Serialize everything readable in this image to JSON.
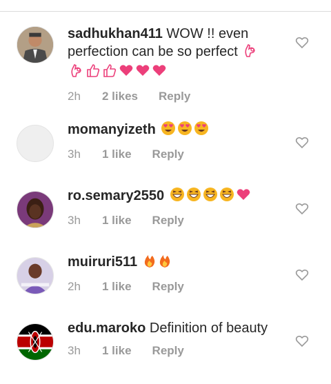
{
  "comments": [
    {
      "username": "sadhukhan411",
      "text_line1": " WOW !! even",
      "text_line2": "perfection can be so perfect",
      "emojis_line2": [
        "ok-hand"
      ],
      "emojis_line3": [
        "ok-hand",
        "thumbs-up",
        "thumbs-up",
        "heart",
        "heart",
        "heart"
      ],
      "time": "2h",
      "likes": "2 likes",
      "reply": "Reply",
      "avatar": "man-in-suit"
    },
    {
      "username": "momanyizeth",
      "text": "",
      "emojis": [
        "heart-eyes",
        "heart-eyes",
        "heart-eyes"
      ],
      "time": "3h",
      "likes": "1 like",
      "reply": "Reply",
      "avatar": "blank"
    },
    {
      "username": "ro.semary2550",
      "text": "",
      "emojis": [
        "laughing",
        "laughing",
        "laughing",
        "laughing",
        "heart"
      ],
      "time": "3h",
      "likes": "1 like",
      "reply": "Reply",
      "avatar": "woman-portrait"
    },
    {
      "username": "muiruri511",
      "text": "",
      "emojis": [
        "fire",
        "fire"
      ],
      "time": "2h",
      "likes": "1 like",
      "reply": "Reply",
      "avatar": "person-purple"
    },
    {
      "username": "edu.maroko",
      "text": " Definition of beauty",
      "emojis": [],
      "time": "3h",
      "likes": "1 like",
      "reply": "Reply",
      "avatar": "kenya-flag"
    }
  ],
  "colors": {
    "text": "#262626",
    "meta": "#999999",
    "heart_outline": "#999999",
    "emoji_heart": "#ec3f7a",
    "emoji_face": "#f7b521"
  }
}
